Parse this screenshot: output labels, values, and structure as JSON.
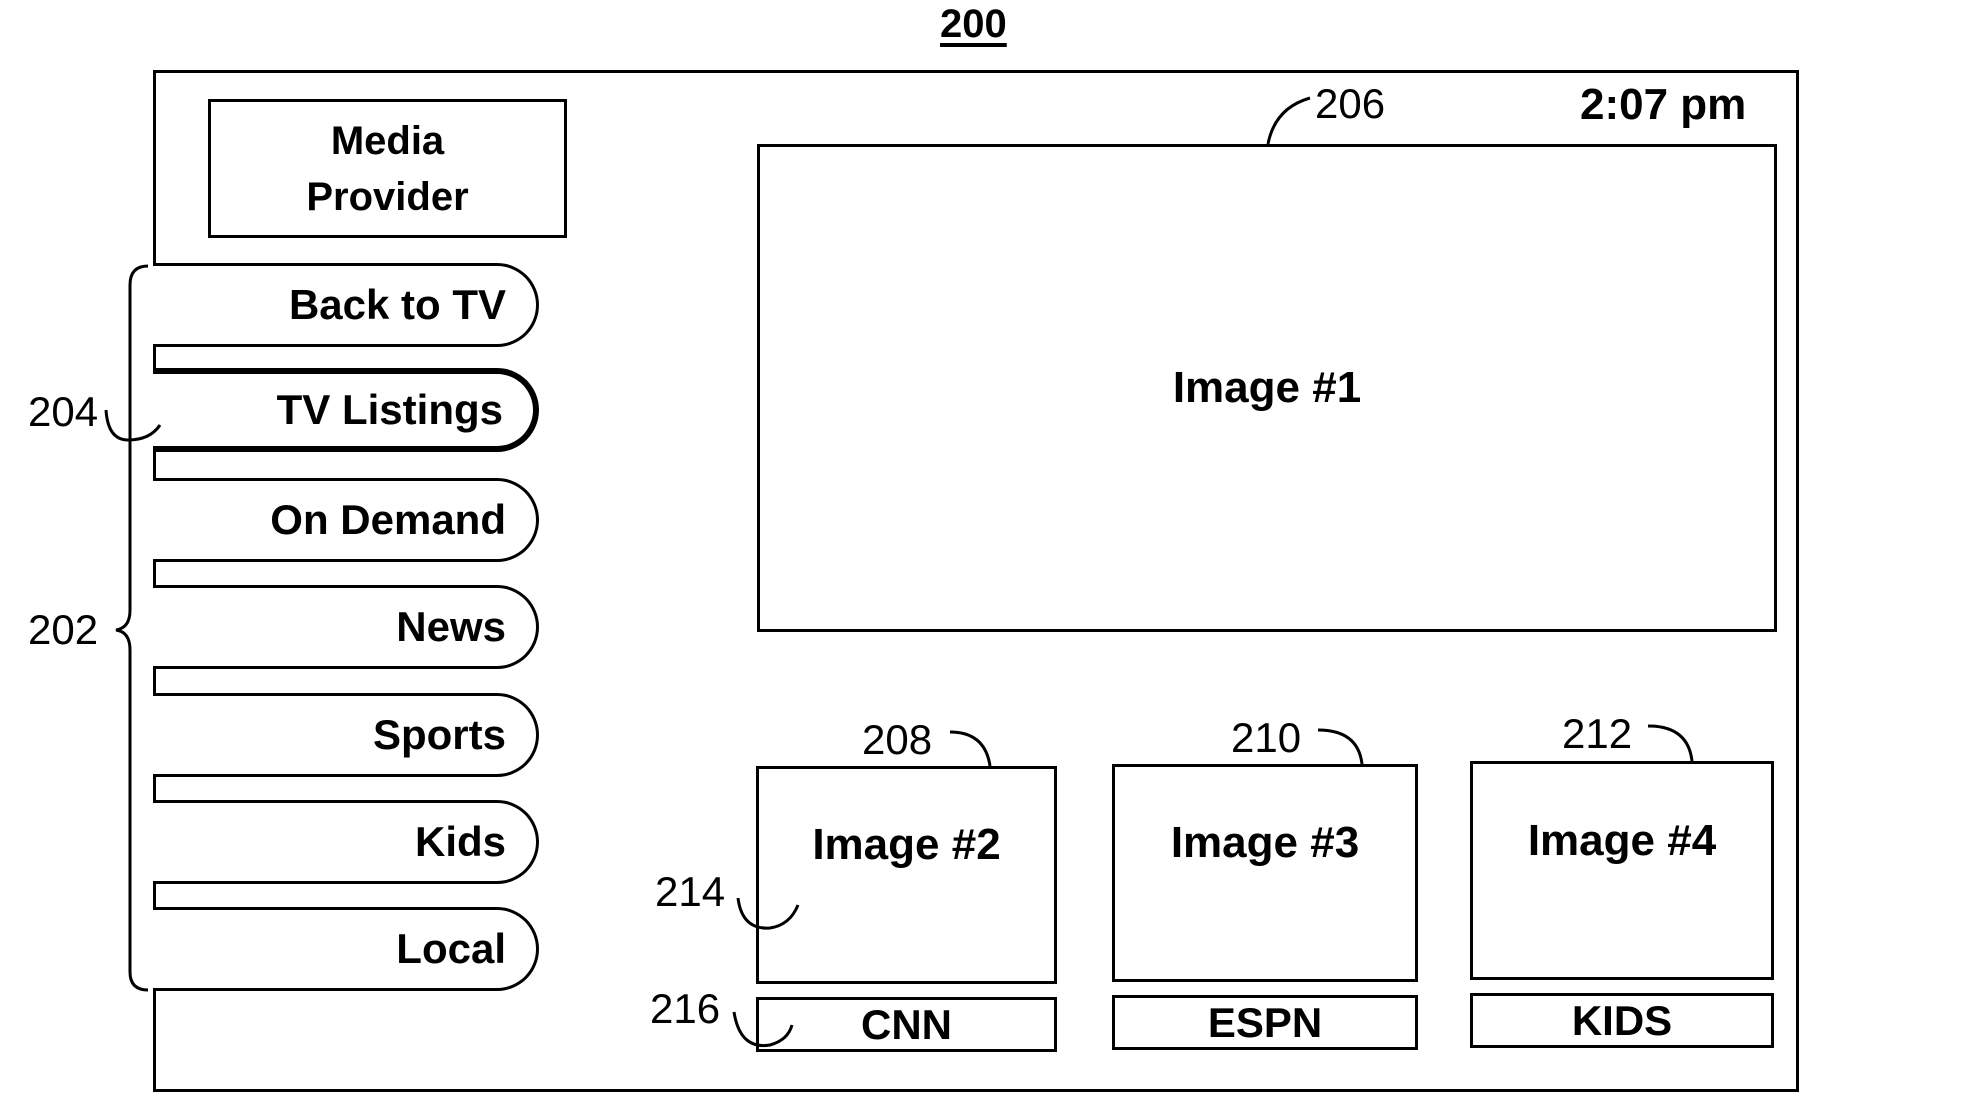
{
  "figure": {
    "number": "200",
    "reference_labels": {
      "menu_group": "202",
      "selected_item": "204",
      "main_image": "206",
      "thumb_1": "208",
      "thumb_2": "210",
      "thumb_3": "212",
      "thumb_image": "214",
      "channel_label": "216"
    }
  },
  "screen": {
    "provider_line1": "Media",
    "provider_line2": "Provider",
    "clock": "2:07 pm",
    "menu": {
      "selected_index": 1,
      "items": [
        {
          "label": "Back to TV"
        },
        {
          "label": "TV Listings"
        },
        {
          "label": "On Demand"
        },
        {
          "label": "News"
        },
        {
          "label": "Sports"
        },
        {
          "label": "Kids"
        },
        {
          "label": "Local"
        }
      ]
    },
    "main_image": {
      "label": "Image #1"
    },
    "thumbnails": [
      {
        "image": "Image #2",
        "channel": "CNN"
      },
      {
        "image": "Image #3",
        "channel": "ESPN"
      },
      {
        "image": "Image #4",
        "channel": "KIDS"
      }
    ]
  }
}
